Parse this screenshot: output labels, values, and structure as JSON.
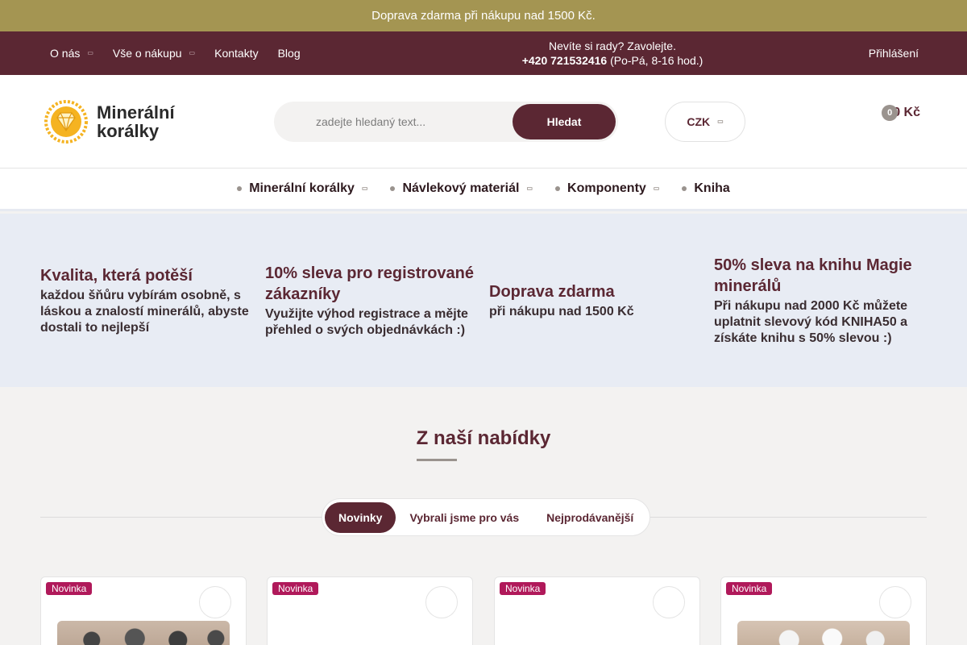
{
  "promo": {
    "text": "Doprava zdarma při nákupu nad 1500 Kč.",
    "close_icon": ""
  },
  "topnav": {
    "links": [
      {
        "label": "O nás",
        "dropdown": true
      },
      {
        "label": "Vše o nákupu",
        "dropdown": true
      },
      {
        "label": "Kontakty",
        "dropdown": false
      },
      {
        "label": "Blog",
        "dropdown": false
      }
    ],
    "help_line": "Nevíte si rady? Zavolejte.",
    "phone_icon": "",
    "phone": "+420 721532416",
    "hours": "(Po-Pá, 8-16 hod.)",
    "heart_icon": "",
    "user_icon": "",
    "login_label": "Přihlášení",
    "caret_icon": "▭"
  },
  "header": {
    "logo": {
      "line1": "Minerální",
      "line2": "korálky"
    },
    "search": {
      "icon": "",
      "placeholder": "zadejte hledaný text...",
      "button": "Hledat"
    },
    "currency": "CZK",
    "cart": {
      "icon": "",
      "count": "0",
      "total": "0 Kč"
    }
  },
  "categories": [
    {
      "label": "Minerální korálky",
      "dropdown": true
    },
    {
      "label": "Návlekový materiál",
      "dropdown": true
    },
    {
      "label": "Komponenty",
      "dropdown": true
    },
    {
      "label": "Kniha",
      "dropdown": false
    }
  ],
  "benefits": [
    {
      "title": "Kvalita, která potěší",
      "desc": "každou šňůru vybírám osobně, s láskou a znalostí minerálů, abyste dostali to nejlepší"
    },
    {
      "title": "10% sleva pro registrované zákazníky",
      "desc": "Využijte výhod registrace a mějte přehled o svých objednávkách :)"
    },
    {
      "title": "Doprava zdarma",
      "desc": "při nákupu nad 1500 Kč"
    },
    {
      "title": "50% sleva na knihu Magie minerálů",
      "desc": "Při nákupu nad 2000 Kč můžete uplatnit slevový kód KNIHA50 a získáte knihu s 50% slevou :)"
    }
  ],
  "offers": {
    "title": "Z naší nabídky",
    "tabs": [
      "Novinky",
      "Vybrali jsme pro vás",
      "Nejprodávanější"
    ],
    "active_tab": 0,
    "products": [
      {
        "badge": "Novinka",
        "wish_icon": ""
      },
      {
        "badge": "Novinka",
        "wish_icon": ""
      },
      {
        "badge": "Novinka",
        "wish_icon": ""
      },
      {
        "badge": "Novinka",
        "wish_icon": ""
      }
    ]
  },
  "colors": {
    "brand": "#5b2733",
    "promo": "#a49552",
    "badge": "#b0195a",
    "benefits_bg": "#e8ecf4"
  }
}
